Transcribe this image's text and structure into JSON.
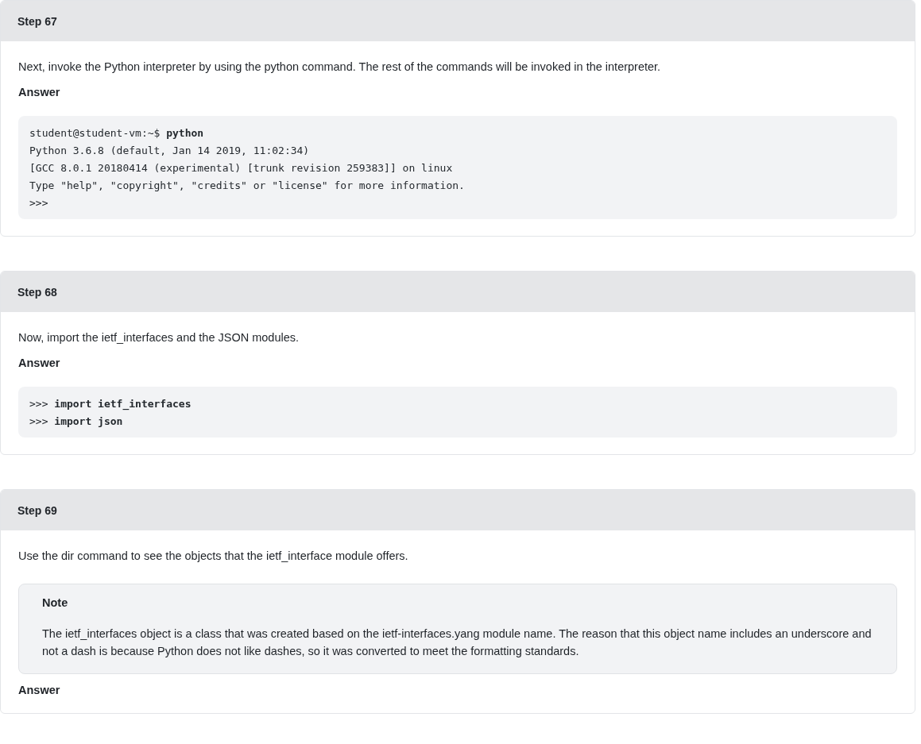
{
  "steps": [
    {
      "title": "Step 67",
      "blocks": [
        {
          "kind": "text",
          "text": "Next, invoke the Python interpreter by using the python command. The rest of the commands will be invoked in the interpreter."
        },
        {
          "kind": "label",
          "text": "Answer"
        },
        {
          "kind": "code",
          "lines": [
            "student@student-vm:~$ **python**",
            "Python 3.6.8 (default, Jan 14 2019, 11:02:34)",
            "[GCC 8.0.1 20180414 (experimental) [trunk revision 259383]] on linux",
            "Type \"help\", \"copyright\", \"credits\" or \"license\" for more information.",
            ">>>"
          ]
        }
      ]
    },
    {
      "title": "Step 68",
      "blocks": [
        {
          "kind": "text",
          "text": "Now, import the ietf_interfaces and the JSON modules."
        },
        {
          "kind": "label",
          "text": "Answer"
        },
        {
          "kind": "code",
          "lines": [
            ">>> **import ietf_interfaces**",
            ">>> **import json**"
          ]
        }
      ]
    },
    {
      "title": "Step 69",
      "blocks": [
        {
          "kind": "text",
          "text": "Use the dir command to see the objects that the ietf_interface module offers."
        },
        {
          "kind": "note",
          "title": "Note",
          "text": "The ietf_interfaces object is a class that was created based on the ietf-interfaces.yang module name. The reason that this object name includes an underscore and not a dash is because Python does not like dashes, so it was converted to meet the formatting standards."
        },
        {
          "kind": "label",
          "text": "Answer"
        }
      ]
    }
  ]
}
